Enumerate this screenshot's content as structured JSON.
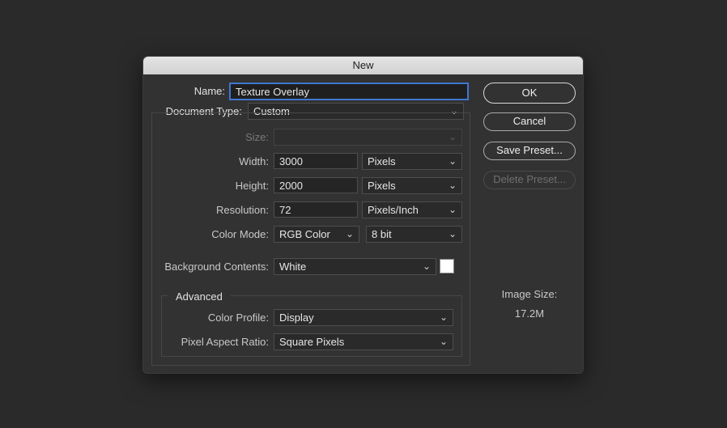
{
  "dialog": {
    "title": "New",
    "name_label": "Name:",
    "name_value": "Texture Overlay",
    "document_type_label": "Document Type:",
    "document_type_value": "Custom",
    "size_label": "Size:",
    "size_value": "",
    "width_label": "Width:",
    "width_value": "3000",
    "width_unit": "Pixels",
    "height_label": "Height:",
    "height_value": "2000",
    "height_unit": "Pixels",
    "resolution_label": "Resolution:",
    "resolution_value": "72",
    "resolution_unit": "Pixels/Inch",
    "color_mode_label": "Color Mode:",
    "color_mode_value": "RGB Color",
    "bit_depth_value": "8 bit",
    "background_label": "Background Contents:",
    "background_value": "White",
    "background_swatch_color": "#ffffff",
    "advanced_label": "Advanced",
    "color_profile_label": "Color Profile:",
    "color_profile_value": "Display",
    "pixel_aspect_label": "Pixel Aspect Ratio:",
    "pixel_aspect_value": "Square Pixels",
    "buttons": {
      "ok": "OK",
      "cancel": "Cancel",
      "save_preset": "Save Preset...",
      "delete_preset": "Delete Preset..."
    },
    "image_size_label": "Image Size:",
    "image_size_value": "17.2M"
  },
  "icons": {
    "dropdown": "chevron-down-icon"
  },
  "colors": {
    "focus_ring": "#3f77d0",
    "background": "#2a2a2a",
    "dialog": "#323232"
  }
}
